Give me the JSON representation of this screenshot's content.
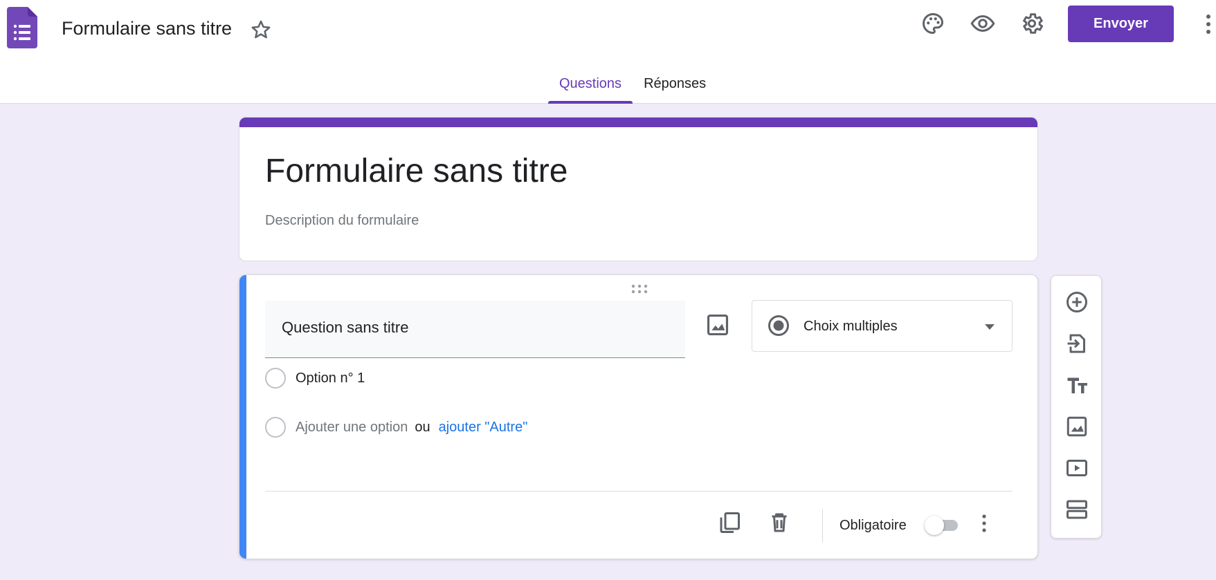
{
  "header": {
    "form_name": "Formulaire sans titre",
    "send_label": "Envoyer",
    "icons": [
      "palette-icon",
      "eye-icon",
      "gear-icon",
      "more-vert-icon"
    ]
  },
  "tabs": [
    {
      "label": "Questions",
      "active": true
    },
    {
      "label": "Réponses",
      "active": false
    }
  ],
  "title_card": {
    "title": "Formulaire sans titre",
    "description": "Description du formulaire"
  },
  "question": {
    "title": "Question sans titre",
    "type": "Choix multiples",
    "options": [
      "Option n° 1"
    ],
    "add_option": "Ajouter une option",
    "or": "ou",
    "add_other": "ajouter \"Autre\"",
    "required_label": "Obligatoire",
    "required": false
  },
  "toolbar": {
    "tools": [
      "add-question",
      "import-questions",
      "add-title",
      "add-image",
      "add-video",
      "add-section"
    ]
  },
  "colors": {
    "accent": "#673ab7",
    "background": "#f0ebf8",
    "active_card_bar": "#4285f4",
    "link": "#1a73e8"
  }
}
